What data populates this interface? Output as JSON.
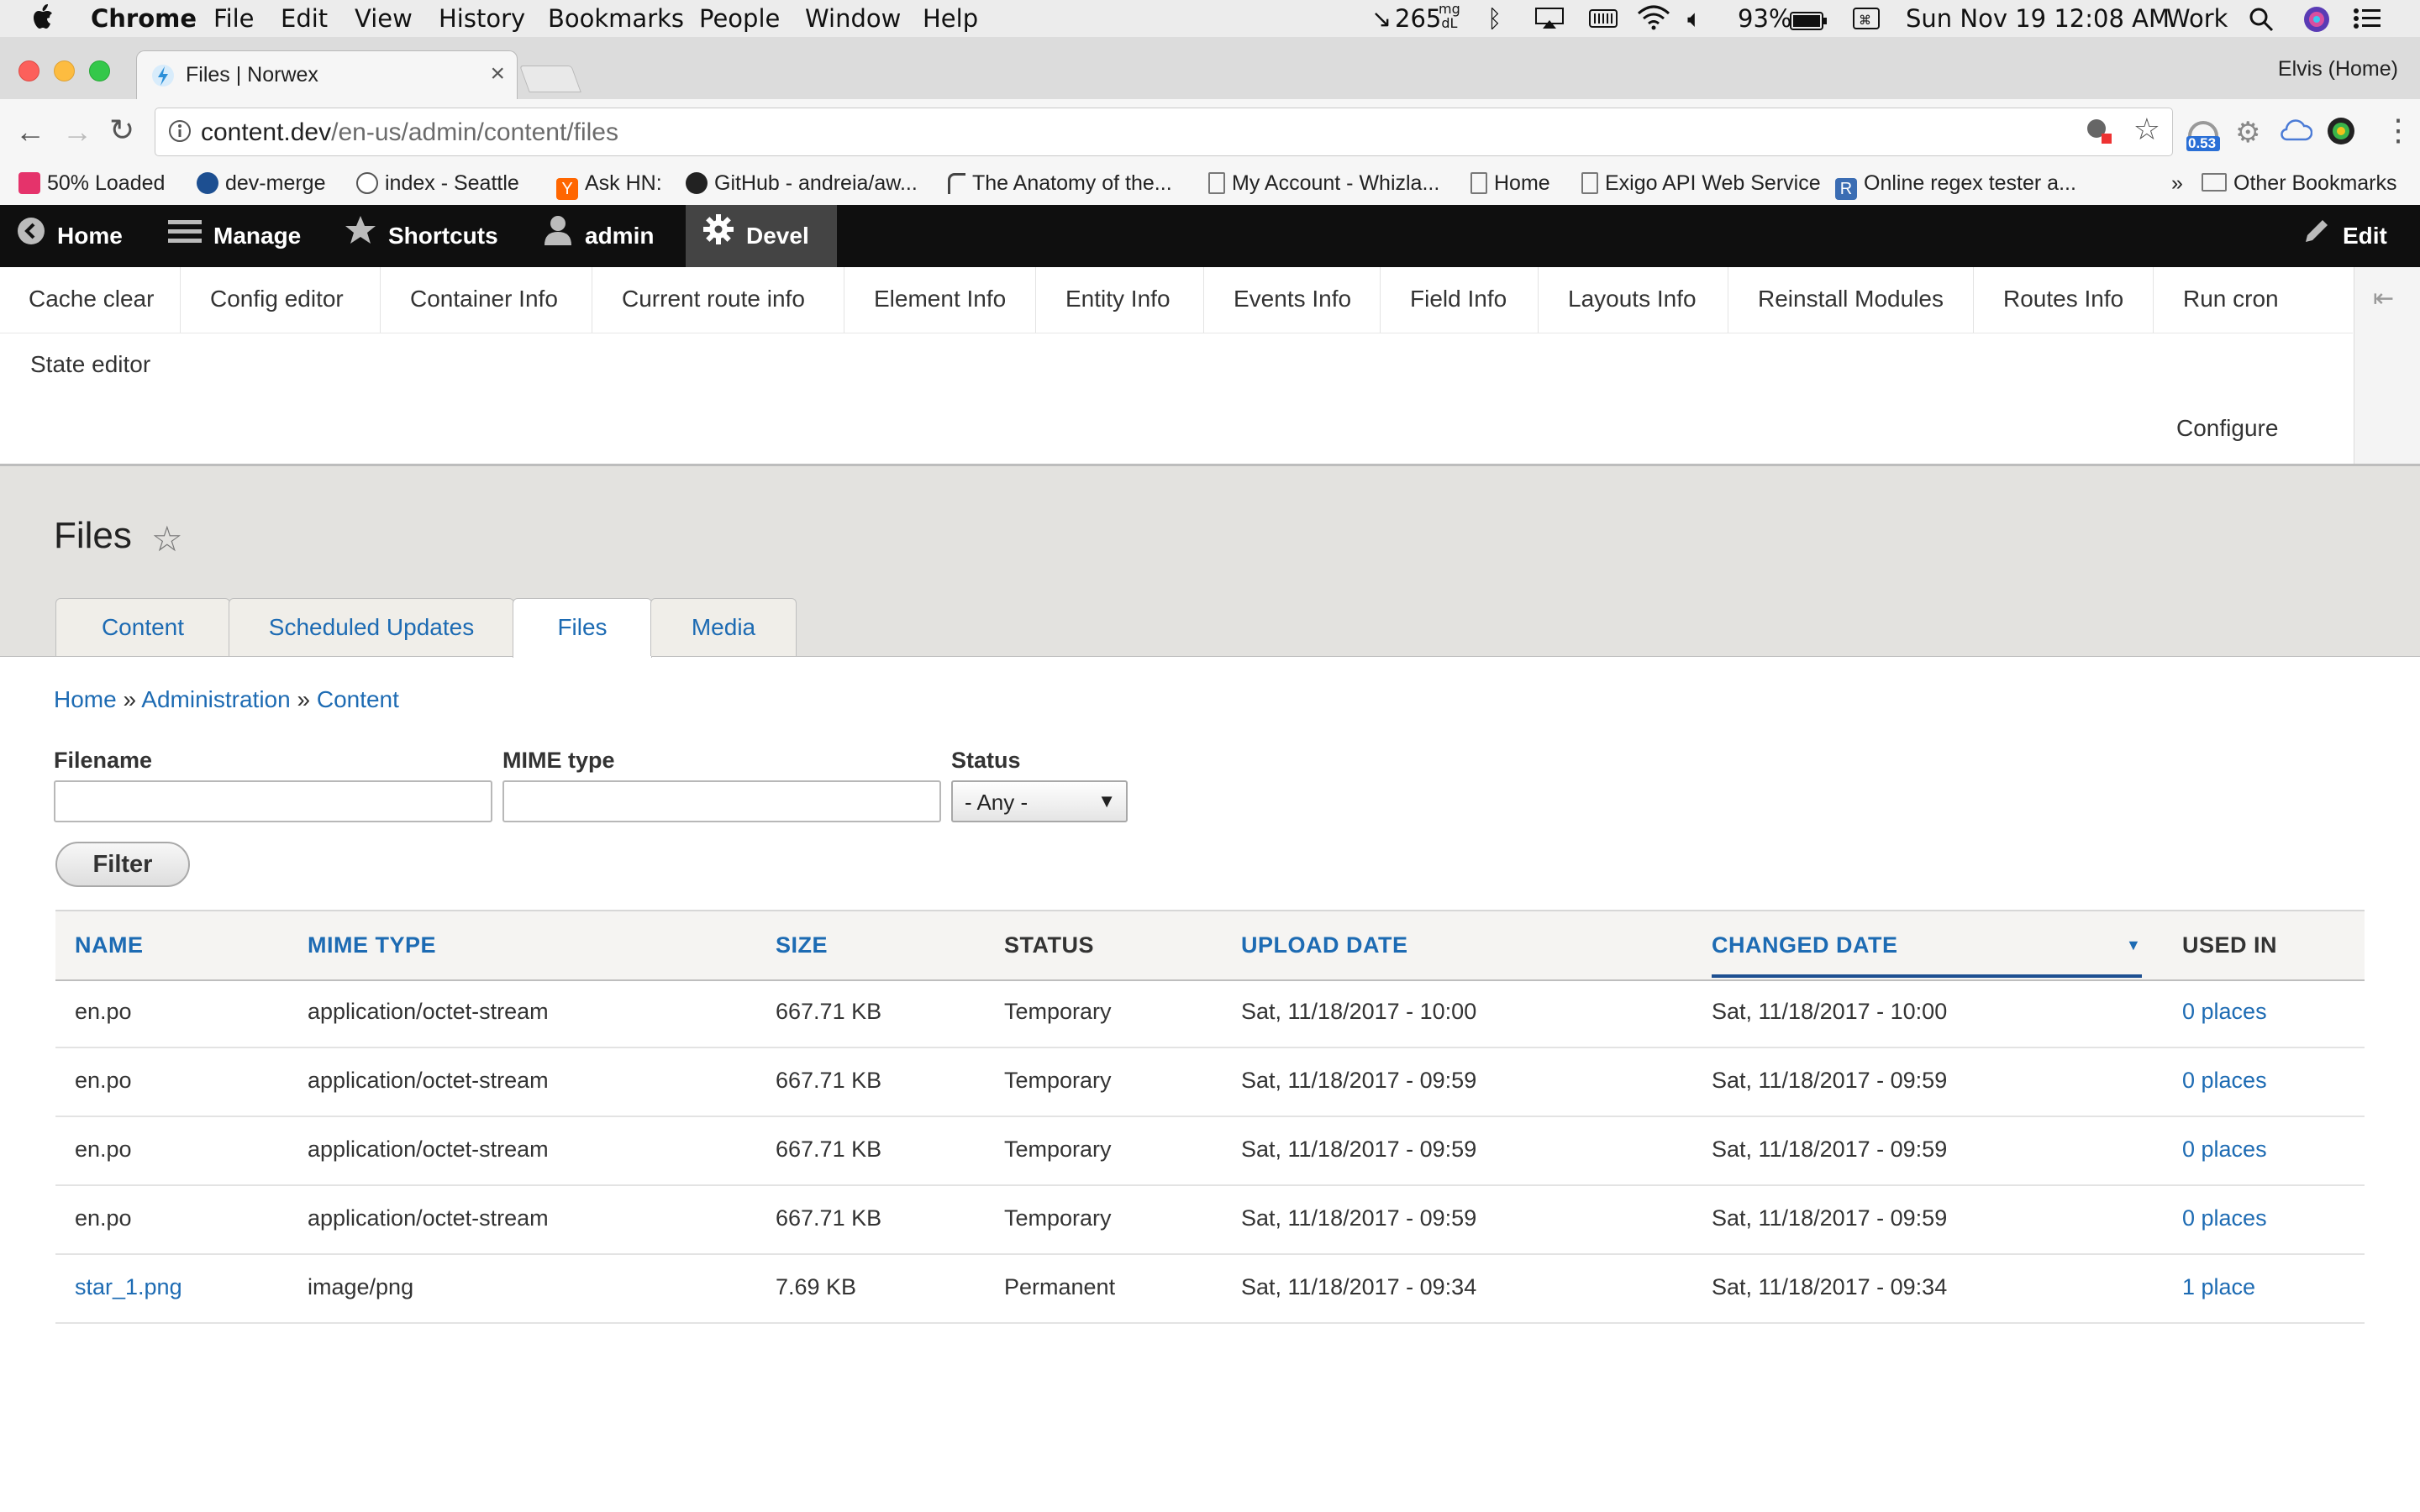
{
  "menubar": {
    "app": "Chrome",
    "items": [
      "File",
      "Edit",
      "View",
      "History",
      "Bookmarks",
      "People",
      "Window",
      "Help"
    ],
    "glucose_value": "265",
    "glucose_unit_top": "mg",
    "glucose_unit_bottom": "dL",
    "battery": "93%",
    "datetime": "Sun Nov 19  12:08 AM",
    "profile": "Work"
  },
  "browser": {
    "tab_title": "Files | Norwex",
    "profile_name": "Elvis (Home)",
    "url_host": "content.dev",
    "url_path": "/en-us/admin/content/files",
    "extension_badge": "0.53"
  },
  "bookmarks": [
    {
      "label": "50% Loaded",
      "icon": "invision-icon",
      "color": "#e5336b"
    },
    {
      "label": "dev-merge",
      "icon": "database-icon",
      "color": "#1d4f91"
    },
    {
      "label": "index - Seattle",
      "icon": "reddit-icon",
      "color": "#555555"
    },
    {
      "label": "Ask HN:",
      "icon": "ycombinator-icon",
      "color": "#ff6600"
    },
    {
      "label": "GitHub - andreia/aw...",
      "icon": "github-icon",
      "color": "#222222"
    },
    {
      "label": "The Anatomy of the...",
      "icon": "bracket-icon",
      "color": "#444444"
    },
    {
      "label": "My Account - Whizla...",
      "icon": "page-icon",
      "color": "#777777"
    },
    {
      "label": "Home",
      "icon": "page-icon",
      "color": "#777777"
    },
    {
      "label": "Exigo API Web Service",
      "icon": "page-icon",
      "color": "#777777"
    },
    {
      "label": "Online regex tester a...",
      "icon": "regex-icon",
      "color": "#3b6db3"
    }
  ],
  "bookmarks_overflow": "»",
  "other_bookmarks": "Other Bookmarks",
  "admin_toolbar": {
    "home": "Home",
    "manage": "Manage",
    "shortcuts": "Shortcuts",
    "user": "admin",
    "devel": "Devel",
    "edit": "Edit"
  },
  "devel_tray": {
    "items": [
      "Cache clear",
      "Config editor",
      "Container Info",
      "Current route info",
      "Element Info",
      "Entity Info",
      "Events Info",
      "Field Info",
      "Layouts Info",
      "Reinstall Modules",
      "Routes Info",
      "Run cron"
    ],
    "second_row": "State editor",
    "configure": "Configure"
  },
  "page": {
    "title": "Files",
    "tabs": [
      "Content",
      "Scheduled Updates",
      "Files",
      "Media"
    ],
    "active_tab": "Files",
    "breadcrumb": [
      "Home",
      "Administration",
      "Content"
    ],
    "breadcrumb_separator": "»"
  },
  "filters": {
    "filename_label": "Filename",
    "filename_value": "",
    "mime_label": "MIME type",
    "mime_value": "",
    "status_label": "Status",
    "status_value": "- Any -",
    "filter_button": "Filter"
  },
  "table": {
    "headers": [
      "NAME",
      "MIME TYPE",
      "SIZE",
      "STATUS",
      "UPLOAD DATE",
      "CHANGED DATE",
      "USED IN"
    ],
    "rows": [
      {
        "name": "en.po",
        "mime": "application/octet-stream",
        "size": "667.71 KB",
        "status": "Temporary",
        "upload": "Sat, 11/18/2017 - 10:00",
        "changed": "Sat, 11/18/2017 - 10:00",
        "used": "0 places"
      },
      {
        "name": "en.po",
        "mime": "application/octet-stream",
        "size": "667.71 KB",
        "status": "Temporary",
        "upload": "Sat, 11/18/2017 - 09:59",
        "changed": "Sat, 11/18/2017 - 09:59",
        "used": "0 places"
      },
      {
        "name": "en.po",
        "mime": "application/octet-stream",
        "size": "667.71 KB",
        "status": "Temporary",
        "upload": "Sat, 11/18/2017 - 09:59",
        "changed": "Sat, 11/18/2017 - 09:59",
        "used": "0 places"
      },
      {
        "name": "en.po",
        "mime": "application/octet-stream",
        "size": "667.71 KB",
        "status": "Temporary",
        "upload": "Sat, 11/18/2017 - 09:59",
        "changed": "Sat, 11/18/2017 - 09:59",
        "used": "0 places"
      },
      {
        "name": "star_1.png",
        "mime": "image/png",
        "size": "7.69 KB",
        "status": "Permanent",
        "upload": "Sat, 11/18/2017 - 09:34",
        "changed": "Sat, 11/18/2017 - 09:34",
        "used": "1 place"
      }
    ]
  },
  "colors": {
    "link": "#1d6bb3",
    "toolbar_bg": "#0f0f0f",
    "header_bg": "#e3e2df"
  }
}
